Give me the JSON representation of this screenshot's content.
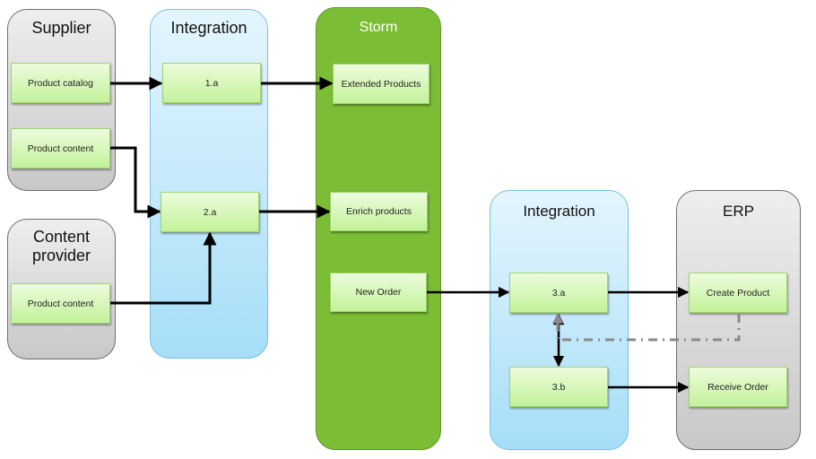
{
  "lanes": {
    "supplier": {
      "title": "Supplier"
    },
    "content_provider": {
      "title": "Content provider",
      "title_line1": "Content",
      "title_line2": "provider"
    },
    "integration_1": {
      "title": "Integration"
    },
    "storm": {
      "title": "Storm"
    },
    "integration_2": {
      "title": "Integration"
    },
    "erp": {
      "title": "ERP"
    }
  },
  "boxes": {
    "product_catalog": "Product catalog",
    "supplier_product_content": "Product content",
    "provider_product_content": "Product content",
    "step_1a": "1.a",
    "step_2a": "2.a",
    "extended_products": "Extended Products",
    "enrich_products": "Enrich products",
    "new_order": "New  Order",
    "step_3a": "3.a",
    "step_3b": "3.b",
    "create_product": "Create Product",
    "receive_order": "Receive Order"
  },
  "connections": [
    {
      "from": "Product catalog",
      "to": "1.a",
      "style": "solid"
    },
    {
      "from": "1.a",
      "to": "Extended Products",
      "style": "solid"
    },
    {
      "from": "Product content (Supplier)",
      "to": "2.a",
      "style": "solid"
    },
    {
      "from": "Product content (Content provider)",
      "to": "2.a",
      "style": "solid"
    },
    {
      "from": "2.a",
      "to": "Enrich products",
      "style": "solid"
    },
    {
      "from": "New  Order",
      "to": "3.a",
      "style": "solid"
    },
    {
      "from": "3.a",
      "to": "Create Product",
      "style": "solid"
    },
    {
      "from": "3.a",
      "to": "3.b",
      "style": "solid-bidirectional"
    },
    {
      "from": "Create Product",
      "to": "3.a",
      "style": "dash-dot"
    },
    {
      "from": "3.b",
      "to": "Receive Order",
      "style": "solid"
    }
  ]
}
